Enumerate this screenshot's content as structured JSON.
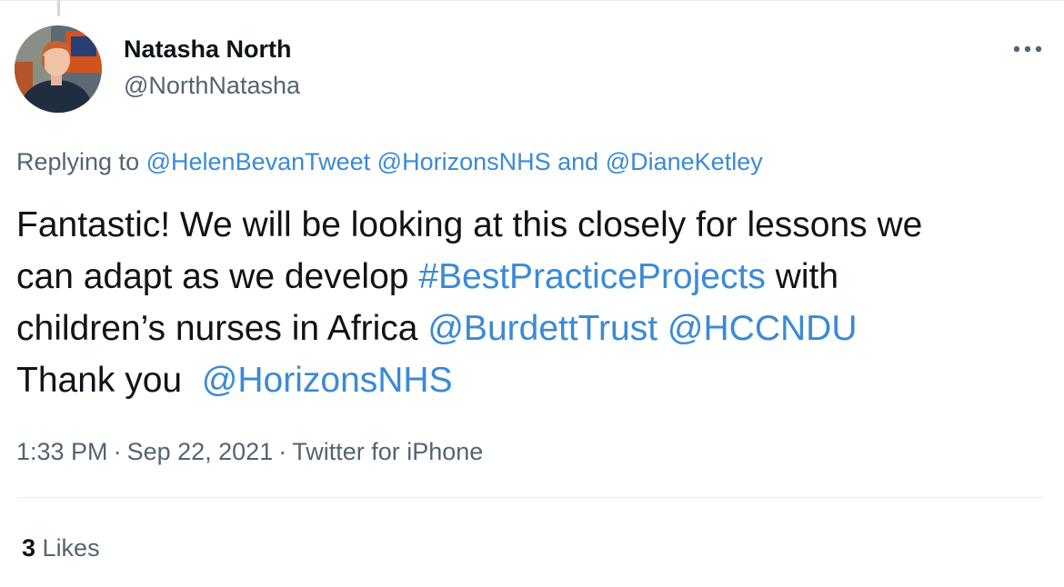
{
  "tweet": {
    "author": {
      "name": "Natasha North",
      "handle": "@NorthNatasha"
    },
    "more_icon": "more-horizontal-icon",
    "replying": {
      "prefix": "Replying to",
      "mentions": [
        "@HelenBevanTweet",
        "@HorizonsNHS",
        "@DianeKetley"
      ],
      "conjunction": "and"
    },
    "text": {
      "line1": "Fantastic! We will be looking at this closely for lessons we",
      "line2_plain": "can adapt as we develop",
      "line2_hashtag": "#BestPracticeProjects",
      "line2_tail": "with",
      "line3_plain": "children’s nurses in Africa",
      "line3_mention1": "@BurdettTrust",
      "line3_mention2": "@HCCNDU",
      "line4_plain": "Thank you",
      "line4_mention": "@HorizonsNHS"
    },
    "meta": {
      "time": "1:33 PM",
      "date": "Sep 22, 2021",
      "source": "Twitter for iPhone",
      "separator": "·"
    },
    "stats": {
      "likes_count": "3",
      "likes_label": "Likes"
    }
  },
  "colors": {
    "link": "#3a8ad6",
    "text": "#0f1419",
    "secondary": "#536471",
    "divider": "#e6ecf0"
  }
}
